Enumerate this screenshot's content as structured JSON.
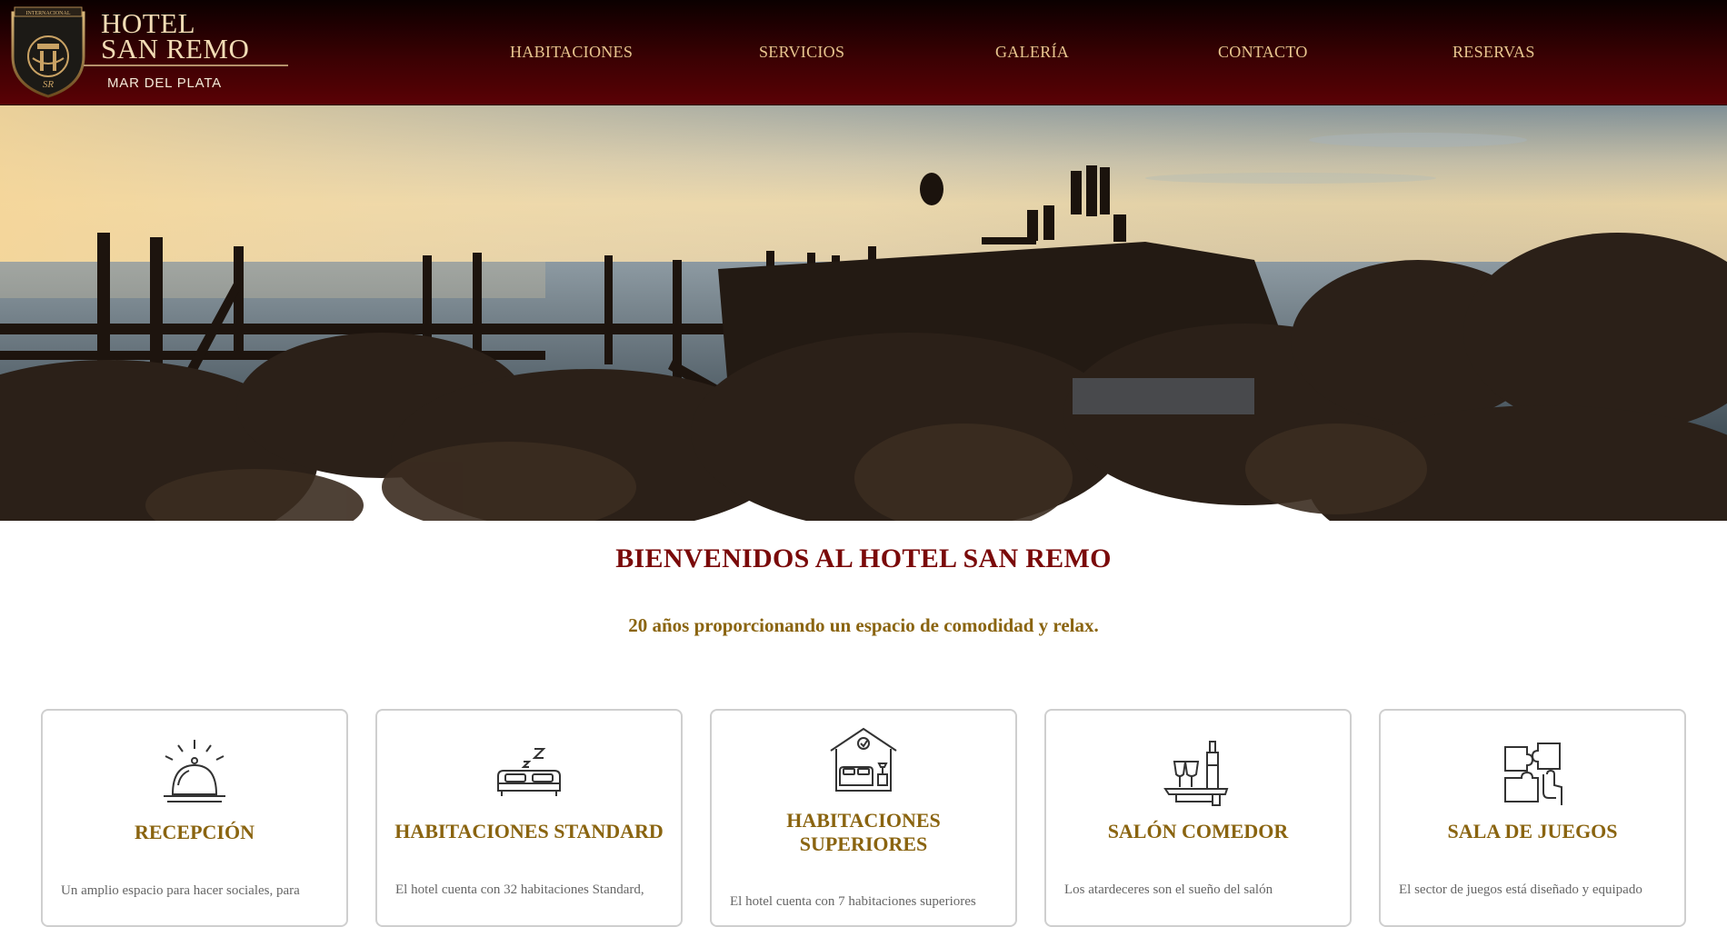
{
  "brand": {
    "name_line1": "HOTEL",
    "name_line2": "SAN REMO",
    "location": "MAR DEL PLATA",
    "logo_text": "INTERNACIONAL"
  },
  "nav": {
    "items": [
      {
        "label": "HABITACIONES"
      },
      {
        "label": "SERVICIOS"
      },
      {
        "label": "GALERÍA"
      },
      {
        "label": "CONTACTO"
      },
      {
        "label": "RESERVAS"
      }
    ]
  },
  "hero": {
    "image_icon": "beach-pier-photo"
  },
  "welcome": {
    "title": "BIENVENIDOS AL HOTEL SAN REMO",
    "tagline": "20 años proporcionando un espacio de comodidad y relax."
  },
  "services": [
    {
      "title": "RECEPCIÓN",
      "icon": "reception-bell-icon",
      "text": "Un amplio espacio para hacer sociales, para"
    },
    {
      "title": "HABITACIONES STANDARD",
      "icon": "bed-icon",
      "text": "El hotel cuenta con 32 habitaciones Standard,"
    },
    {
      "title": "HABITACIONES SUPERIORES",
      "title_line1": "HABITACIONES",
      "title_line2": "SUPERIORES",
      "icon": "superior-room-icon",
      "text": "El hotel cuenta con 7 habitaciones superiores"
    },
    {
      "title": "SALÓN COMEDOR",
      "icon": "dining-icon",
      "text": "Los atardeceres son el sueño del salón"
    },
    {
      "title": "SALA DE JUEGOS",
      "icon": "puzzle-icon",
      "text": "El sector de juegos está diseñado y equipado"
    }
  ],
  "colors": {
    "header_dark": "#0b0000",
    "header_red": "#5a0105",
    "nav_text": "#e8c68f",
    "welcome_title": "#7a0a0a",
    "gold": "#8a6410"
  }
}
